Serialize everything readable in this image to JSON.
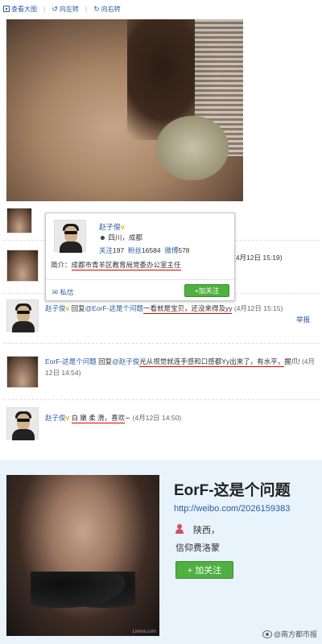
{
  "toolbar": {
    "view_large": "查看大图",
    "rotate_left": "向左转",
    "rotate_right": "向右转"
  },
  "popup": {
    "name": "赵子俊",
    "location": "四川，成都",
    "follow_label": "关注",
    "follow_count": "197",
    "fans_label": "粉丝",
    "fans_count": "16584",
    "weibo_label": "微博",
    "weibo_count": "578",
    "bio_label": "简介：",
    "bio": "成都市青羊区教育局党委办公室主任",
    "pm": "私信",
    "follow_button": "+加关注"
  },
  "comments": [
    {
      "date": "(4月12日 15:19)"
    },
    {
      "name": "赵子俊",
      "verified": "V",
      "text_pre": "回复",
      "mention": "@EorF-这是个问题",
      "text_hl": "一看就是宝贝，还没来得及yy",
      "date": "(4月12日 15:15)",
      "extra": "举报"
    },
    {
      "name": "EorF-这是个问题",
      "text_pre": "回复",
      "mention": "@赵子俊",
      "text_hl": "光从视觉就连手感和口感都Yy出来了，有水平，",
      "text_post": "握爪!",
      "date": "(4月12日 14:54)"
    },
    {
      "name": "赵子俊",
      "verified": "V",
      "text_hl": "白 嫩 柔 滑，喜欢",
      "text_post": "∽",
      "date": "(4月12日 14:50)"
    }
  ],
  "profile": {
    "name": "EorF-这是个问题",
    "url": "http://weibo.com/2026159383",
    "region": "陕西，",
    "bio": "信仰费洛蒙",
    "follow_button": "+ 加关注",
    "photo_watermark": "Liema.com"
  },
  "watermark": "@南方都市报"
}
